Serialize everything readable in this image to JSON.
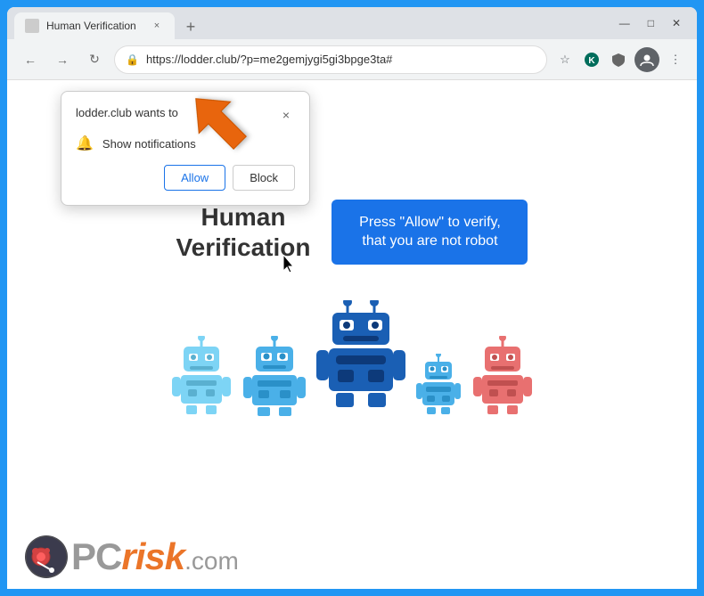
{
  "browser": {
    "title": "Human Verification",
    "url": "https://lodder.club/?p=me2gemjygi5gi3bpge3ta#",
    "tab_close": "×",
    "new_tab": "+",
    "window_controls": [
      "—",
      "□",
      "×"
    ]
  },
  "notification_popup": {
    "title": "lodder.club wants to",
    "notification_label": "Show notifications",
    "close": "×",
    "allow_btn": "Allow",
    "block_btn": "Block"
  },
  "page": {
    "heading_line1": "Human",
    "heading_line2": "Verification",
    "cta_text": "Press \"Allow\" to verify, that you are not robot"
  },
  "pcrisk": {
    "text": "PC",
    "suffix": "risk",
    "dotcom": ".com"
  },
  "colors": {
    "blue_accent": "#1a73e8",
    "orange_arrow": "#e8650a",
    "robot1": "#7dd4f5",
    "robot2": "#4ab0e8",
    "robot3": "#1a5fb4",
    "robot4": "#4ab0e8",
    "robot5": "#e87070"
  }
}
